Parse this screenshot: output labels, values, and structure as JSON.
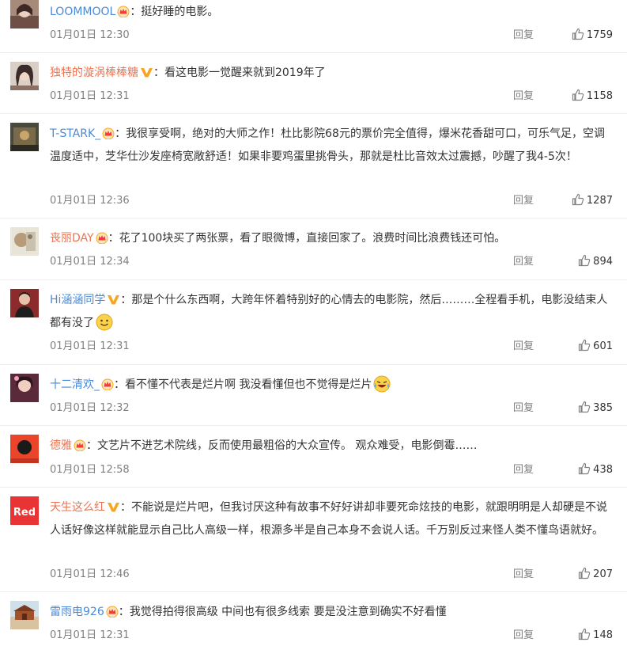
{
  "colors": {
    "username": "#eb7350",
    "username_alt": "#4a8ad8",
    "meta": "#808080",
    "crown": "#f6a623",
    "vip": "#f6a623"
  },
  "comments": [
    {
      "user": "LOOMMOOL",
      "badge": "crown-icon",
      "sep": "：",
      "text": "挺好睡的电影。",
      "time": "01月01日 12:30",
      "reply": "回复",
      "likes": "1759"
    },
    {
      "user": "独特的漩涡棒棒糖",
      "badge": "vip-v-icon",
      "sep": "：",
      "text": "看这电影一觉醒来就到2019年了",
      "time": "01月01日 12:31",
      "reply": "回复",
      "likes": "1158"
    },
    {
      "user": "T-STARK_",
      "badge": "crown-icon",
      "sep": "：",
      "text": "我很享受啊，绝对的大师之作！杜比影院68元的票价完全值得，爆米花香甜可口，可乐气足，空调温度适中，芝华仕沙发座椅宽敞舒适！如果非要鸡蛋里挑骨头，那就是杜比音效太过震撼，吵醒了我4-5次！",
      "time": "01月01日 12:36",
      "reply": "回复",
      "likes": "1287"
    },
    {
      "user": "丧丽DAY",
      "badge": "crown-icon",
      "sep": "：",
      "text": "花了100块买了两张票，看了眼微博，直接回家了。浪费时间比浪费钱还可怕。",
      "time": "01月01日 12:34",
      "reply": "回复",
      "likes": "894"
    },
    {
      "user": "Hi涵涵同学",
      "badge": "vip-v-icon",
      "sep": "：",
      "text": "那是个什么东西啊，大跨年怀着特别好的心情去的电影院，然后………全程看手机，电影没结束人都有没了",
      "emoji": "smile-emoji-icon",
      "time": "01月01日 12:31",
      "reply": "回复",
      "likes": "601"
    },
    {
      "user": "十二清欢_",
      "badge": "crown-icon",
      "sep": "：",
      "text": "看不懂不代表是烂片啊 我没看懂但也不觉得是烂片",
      "emoji": "laugh-cry-emoji-icon",
      "time": "01月01日 12:32",
      "reply": "回复",
      "likes": "385"
    },
    {
      "user": "德雅",
      "badge": "crown-icon",
      "sep": "：",
      "text": "文艺片不进艺术院线，反而使用最粗俗的大众宣传。 观众难受，电影倒霉……",
      "time": "01月01日 12:58",
      "reply": "回复",
      "likes": "438"
    },
    {
      "user": "天生这么红",
      "badge": "vip-v-icon",
      "sep": "：",
      "text": "不能说是烂片吧，但我讨厌这种有故事不好好讲却非要死命炫技的电影，就跟明明是人却硬是不说人话好像这样就能显示自己比人高级一样，根源多半是自己本身不会说人话。千万别反过来怪人类不懂鸟语就好。",
      "time": "01月01日 12:46",
      "reply": "回复",
      "likes": "207"
    },
    {
      "user": "雷雨电926",
      "badge": "crown-icon",
      "sep": "：",
      "text": "我觉得拍得很高级 中间也有很多线索 要是没注意到确实不好看懂",
      "time": "01月01日 12:31",
      "reply": "回复",
      "likes": "148"
    }
  ]
}
